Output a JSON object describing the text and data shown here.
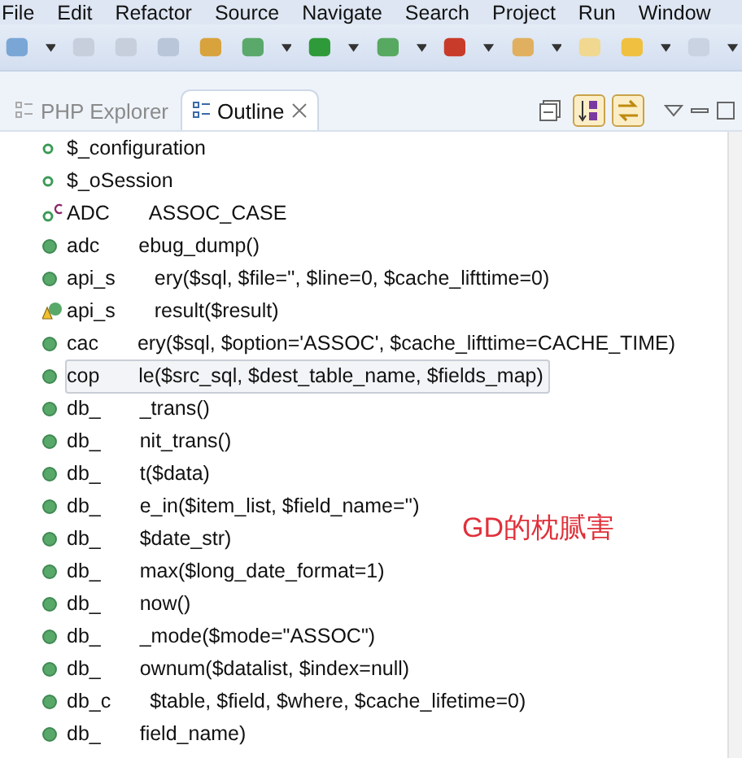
{
  "menu": [
    "File",
    "Edit",
    "Refactor",
    "Source",
    "Navigate",
    "Search",
    "Project",
    "Run",
    "Window"
  ],
  "tabs": [
    {
      "label": "PHP Explorer",
      "selected": false,
      "closable": false
    },
    {
      "label": "Outline",
      "selected": true,
      "closable": true
    }
  ],
  "view_buttons": [
    {
      "kind": "collapse",
      "on": false
    },
    {
      "kind": "sort",
      "on": true
    },
    {
      "kind": "link",
      "on": true
    }
  ],
  "outline": [
    {
      "kind": "field",
      "head": "$_configuration"
    },
    {
      "kind": "field",
      "head": "$_oSession"
    },
    {
      "kind": "constant",
      "head": "ADC",
      "tail": "ASSOC_CASE"
    },
    {
      "kind": "method",
      "head": "adc",
      "tail": "ebug_dump()"
    },
    {
      "kind": "method",
      "head": "api_s",
      "tail": "ery($sql, $file='', $line=0, $cache_lifttime=0)"
    },
    {
      "kind": "warning",
      "head": "api_s",
      "tail": "result($result)"
    },
    {
      "kind": "method",
      "head": "cac",
      "tail": "ery($sql, $option='ASSOC', $cache_lifttime=CACHE_TIME)"
    },
    {
      "kind": "method",
      "head": "cop",
      "tail": "le($src_sql, $dest_table_name, $fields_map)",
      "selected": true
    },
    {
      "kind": "method",
      "head": "db_",
      "tail": "_trans()"
    },
    {
      "kind": "method",
      "head": "db_",
      "tail": "nit_trans()"
    },
    {
      "kind": "method",
      "head": "db_",
      "tail": "t($data)"
    },
    {
      "kind": "method",
      "head": "db_",
      "tail": "e_in($item_list, $field_name='')"
    },
    {
      "kind": "method",
      "head": "db_",
      "tail": "$date_str)"
    },
    {
      "kind": "method",
      "head": "db_",
      "tail": "max($long_date_format=1)"
    },
    {
      "kind": "method",
      "head": "db_",
      "tail": "now()"
    },
    {
      "kind": "method",
      "head": "db_",
      "tail": "_mode($mode=\"ASSOC\")"
    },
    {
      "kind": "method",
      "head": "db_",
      "tail": "ownum($datalist, $index=null)"
    },
    {
      "kind": "method",
      "head": "db_c",
      "tail": "$table, $field, $where, $cache_lifetime=0)"
    },
    {
      "kind": "method",
      "head": "db_",
      "tail": "field_name)"
    }
  ],
  "annotation": "GD的枕腻害"
}
